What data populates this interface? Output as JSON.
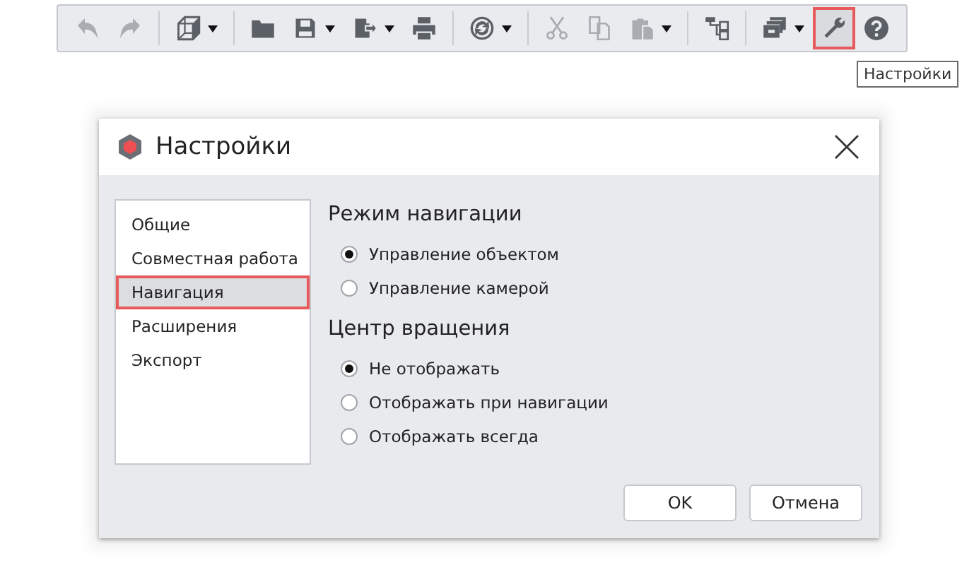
{
  "toolbar": {
    "groups": [
      [
        {
          "kind": "undo",
          "disabled": true,
          "selected": false,
          "has_menu": false
        },
        {
          "kind": "redo",
          "disabled": true,
          "selected": false,
          "has_menu": false
        }
      ],
      [
        {
          "kind": "cube",
          "disabled": false,
          "selected": false,
          "has_menu": true
        }
      ],
      [
        {
          "kind": "folder",
          "disabled": false,
          "selected": false,
          "has_menu": false
        },
        {
          "kind": "save",
          "disabled": false,
          "selected": false,
          "has_menu": true
        },
        {
          "kind": "export",
          "disabled": false,
          "selected": false,
          "has_menu": true
        },
        {
          "kind": "print",
          "disabled": false,
          "selected": false,
          "has_menu": false
        }
      ],
      [
        {
          "kind": "rotate",
          "disabled": false,
          "selected": false,
          "has_menu": true
        }
      ],
      [
        {
          "kind": "cut",
          "disabled": true,
          "selected": false,
          "has_menu": false
        },
        {
          "kind": "copy",
          "disabled": true,
          "selected": false,
          "has_menu": false
        },
        {
          "kind": "paste",
          "disabled": true,
          "selected": false,
          "has_menu": true
        }
      ],
      [
        {
          "kind": "tree",
          "disabled": false,
          "selected": false,
          "has_menu": false
        }
      ],
      [
        {
          "kind": "windows",
          "disabled": false,
          "selected": false,
          "has_menu": true
        },
        {
          "kind": "wrench",
          "disabled": false,
          "selected": true,
          "has_menu": false
        },
        {
          "kind": "help",
          "disabled": false,
          "selected": false,
          "has_menu": false
        }
      ]
    ],
    "tooltip": "Настройки"
  },
  "dialog": {
    "title": "Настройки",
    "sidebar": {
      "items": [
        {
          "label": "Общие",
          "selected": false
        },
        {
          "label": "Совместная работа",
          "selected": false
        },
        {
          "label": "Навигация",
          "selected": true
        },
        {
          "label": "Расширения",
          "selected": false
        },
        {
          "label": "Экспорт",
          "selected": false
        }
      ]
    },
    "sections": [
      {
        "title": "Режим навигации",
        "options": [
          {
            "label": "Управление объектом",
            "selected": true
          },
          {
            "label": "Управление камерой",
            "selected": false
          }
        ]
      },
      {
        "title": "Центр вращения",
        "options": [
          {
            "label": "Не отображать",
            "selected": true
          },
          {
            "label": "Отображать при навигации",
            "selected": false
          },
          {
            "label": "Отображать всегда",
            "selected": false
          }
        ]
      }
    ],
    "buttons": [
      "OK",
      "Отмена"
    ]
  }
}
